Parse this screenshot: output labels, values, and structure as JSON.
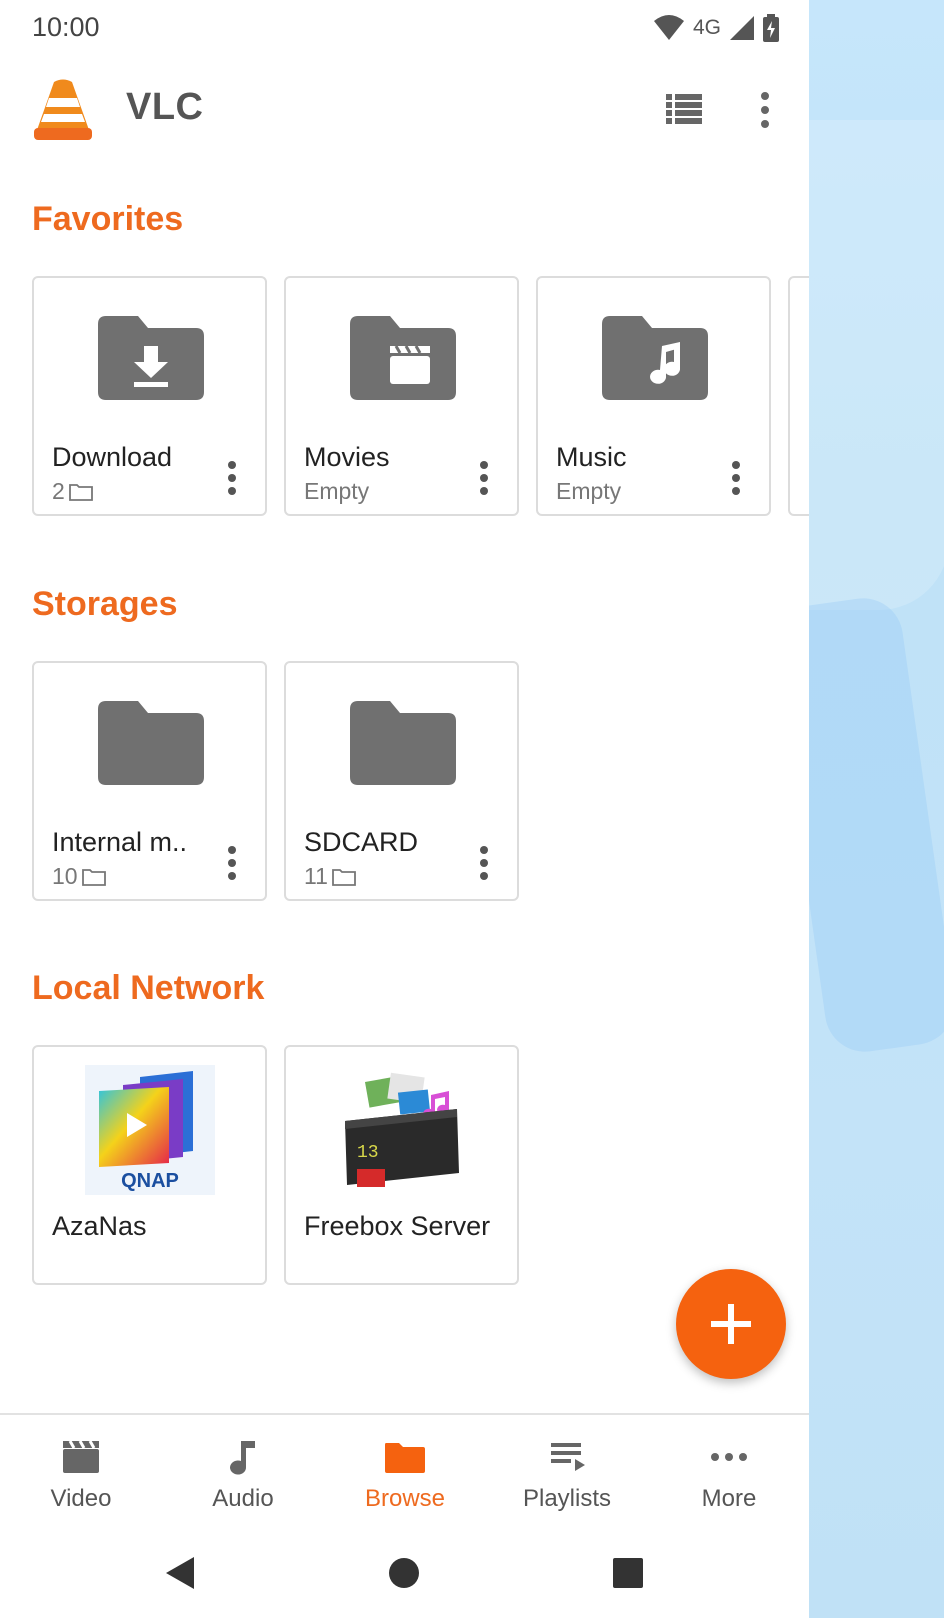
{
  "status_bar": {
    "time": "10:00",
    "network": "4G"
  },
  "app_bar": {
    "title": "VLC"
  },
  "favorites": {
    "title": "Favorites",
    "items": [
      {
        "name": "Download",
        "sub": "2",
        "icon": "download-folder-icon"
      },
      {
        "name": "Movies",
        "sub": "Empty",
        "icon": "movie-folder-icon"
      },
      {
        "name": "Music",
        "sub": "Empty",
        "icon": "music-folder-icon"
      }
    ]
  },
  "storages": {
    "title": "Storages",
    "items": [
      {
        "name": "Internal m..",
        "sub": "10"
      },
      {
        "name": "SDCARD",
        "sub": "11"
      }
    ]
  },
  "local_network": {
    "title": "Local Network",
    "items": [
      {
        "name": "AzaNas",
        "logo_text": "QNAP"
      },
      {
        "name": "Freebox Server"
      }
    ]
  },
  "bottom_nav": {
    "items": [
      {
        "label": "Video",
        "icon": "video-icon"
      },
      {
        "label": "Audio",
        "icon": "audio-icon"
      },
      {
        "label": "Browse",
        "icon": "browse-folder-icon",
        "active": true
      },
      {
        "label": "Playlists",
        "icon": "playlists-icon"
      },
      {
        "label": "More",
        "icon": "more-horizontal-icon"
      }
    ]
  },
  "colors": {
    "accent": "#ee6a1f",
    "fab": "#f5620f",
    "icon_gray": "#707070"
  }
}
